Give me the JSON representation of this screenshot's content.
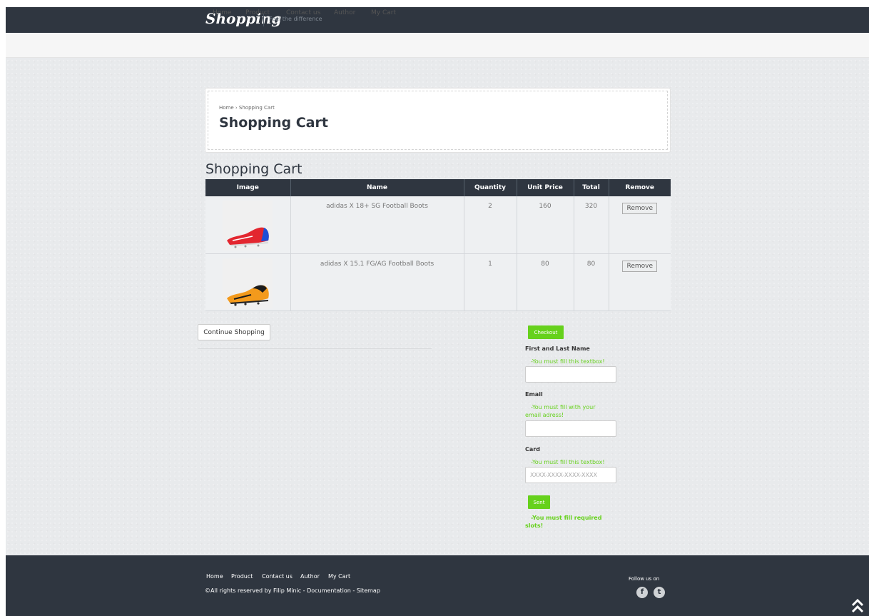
{
  "header": {
    "logo": "Shopping",
    "tagline": "Feel the difference"
  },
  "nav": {
    "items": [
      "Home",
      "Product",
      "Contact us",
      "Author",
      "My Cart"
    ]
  },
  "title_panel": {
    "breadcrumb": "Home › Shopping Cart",
    "title": "Shopping Cart"
  },
  "cart": {
    "heading": "Shopping Cart",
    "columns": [
      "Image",
      "Name",
      "Quantity",
      "Unit Price",
      "Total",
      "Remove"
    ],
    "rows": [
      {
        "name": "adidas X 18+ SG Football Boots",
        "quantity": "2",
        "unit_price": "160",
        "total": "320",
        "remove_label": "Remove",
        "image_icon": "red-football-boot"
      },
      {
        "name": "adidas X 15.1 FG/AG Football Boots",
        "quantity": "1",
        "unit_price": "80",
        "total": "80",
        "remove_label": "Remove",
        "image_icon": "orange-football-boot"
      }
    ],
    "continue_label": "Continue Shopping"
  },
  "checkout": {
    "checkout_label": "Checkout",
    "name_label": "First and Last Name",
    "name_warning": "-You must fill this textbox!",
    "name_value": "",
    "email_label": "Email",
    "email_warning": "-You must fill with your email adress!",
    "email_value": "",
    "card_label": "Card",
    "card_warning": "-You must fill this textbox!",
    "card_placeholder": "XXXX-XXXX-XXXX-XXXX",
    "send_label": "Sent",
    "form_warning": "-You must fill required slots!",
    "accent_color": "#66d11c"
  },
  "footer": {
    "links": [
      "Home",
      "Product",
      "Contact us",
      "Author",
      "My Cart"
    ],
    "copyright": "©All rights reserved by Filip Minic - Documentation - Sitemap",
    "follow": "Follow us on",
    "social": [
      "f",
      "t"
    ],
    "scroll_top_icon": "double-chevron-up-icon"
  }
}
